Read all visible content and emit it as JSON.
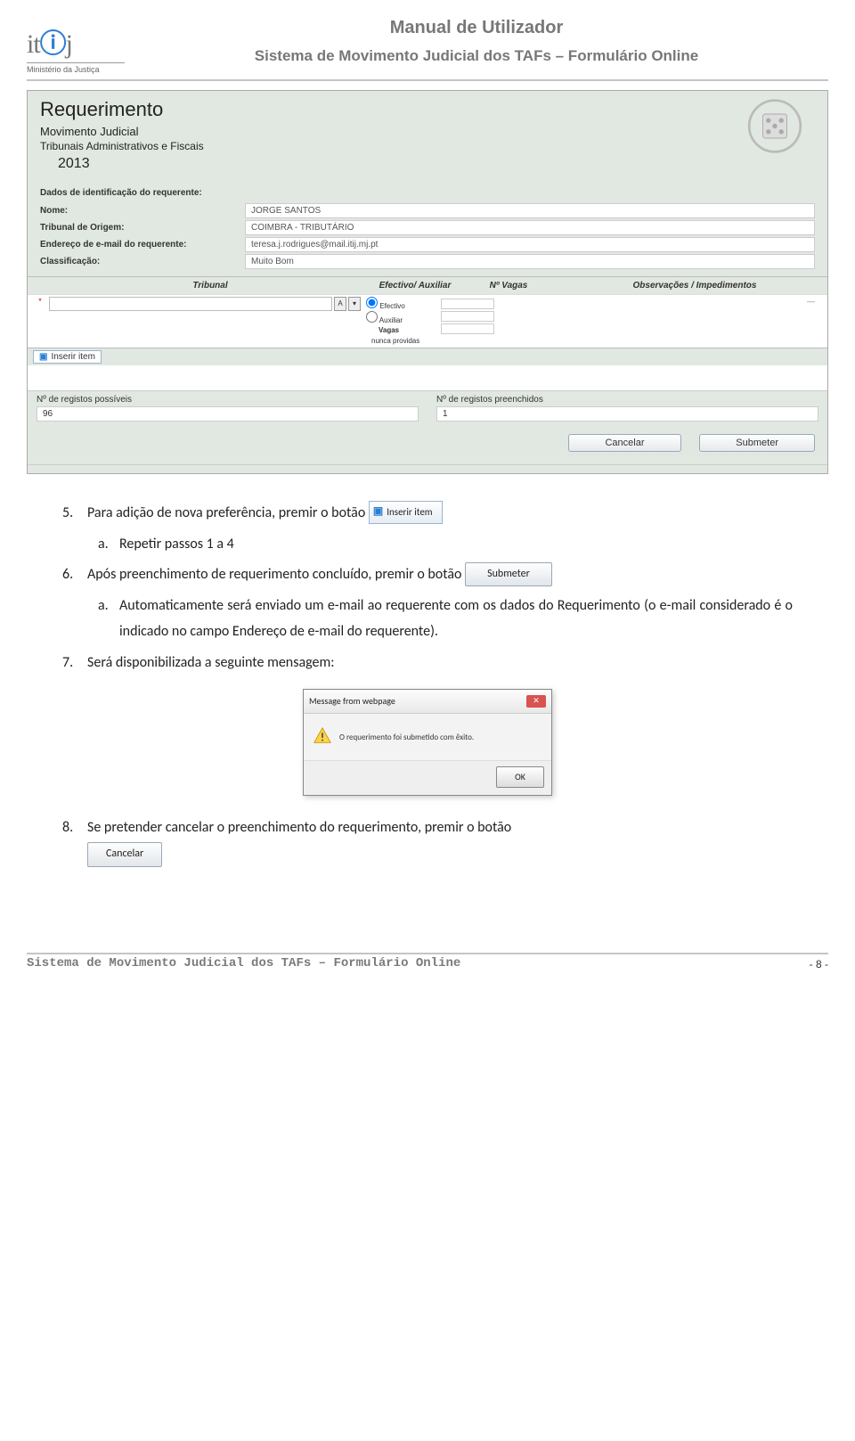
{
  "header": {
    "logo_text_prefix": "it",
    "logo_text_suffix": "j",
    "logo_at": "ⓘ",
    "logo_sub": "Ministério da Justiça",
    "manual_title": "Manual de Utilizador",
    "system_title": "Sistema de Movimento Judicial dos TAFs – Formulário Online"
  },
  "screenshot": {
    "heading": "Requerimento",
    "sub1": "Movimento Judicial",
    "sub2": "Tribunais Administrativos e Fiscais",
    "year": "2013",
    "ident_title": "Dados de identificação do requerente:",
    "labels": {
      "nome": "Nome:",
      "tribunal": "Tribunal de Origem:",
      "email": "Endereço de e-mail do requerente:",
      "classif": "Classificação:"
    },
    "values": {
      "nome": "JORGE SANTOS",
      "tribunal": "COIMBRA - TRIBUTÁRIO",
      "email": "teresa.j.rodrigues@mail.itij.mj.pt",
      "classif": "Muito Bom"
    },
    "grid_headers": {
      "tribunal": "Tribunal",
      "efectivo": "Efectivo/ Auxiliar",
      "vagas": "Nº Vagas",
      "obs": "Observações / Impedimentos"
    },
    "row_options": {
      "efectivo": "Efectivo",
      "auxiliar": "Auxiliar",
      "vagas": "Vagas",
      "nunca": "nunca providas"
    },
    "insert_label": "Inserir item",
    "counts": {
      "possiveis_label": "Nº de registos possíveis",
      "possiveis_value": "96",
      "preenchidos_label": "Nº de registos preenchidos",
      "preenchidos_value": "1"
    },
    "buttons": {
      "cancelar": "Cancelar",
      "submeter": "Submeter"
    }
  },
  "body": {
    "item5_num": "5.",
    "item5_text_a": "Para adição de nova preferência, premir o botão ",
    "item5_btn": "Inserir item",
    "item5a_num": "a.",
    "item5a_text": "Repetir passos 1 a 4",
    "item6_num": "6.",
    "item6_text": "Após preenchimento de requerimento concluído, premir o botão ",
    "item6_btn": "Submeter",
    "item6a_num": "a.",
    "item6a_text": "Automaticamente será enviado um e-mail ao requerente com os dados do Requerimento (o e-mail considerado é o indicado no campo Endereço de e-mail do requerente).",
    "item7_num": "7.",
    "item7_text": "Será disponibilizada a seguinte mensagem:",
    "dialog_title": "Message from webpage",
    "dialog_msg": "O requerimento foi submetido com êxito.",
    "dialog_ok": "OK",
    "item8_num": "8.",
    "item8_text": "Se pretender cancelar o preenchimento do requerimento, premir o botão",
    "item8_btn": "Cancelar"
  },
  "footer": {
    "text": "Sistema de Movimento Judicial dos TAFs – Formulário Online",
    "page": "- 8 -"
  }
}
